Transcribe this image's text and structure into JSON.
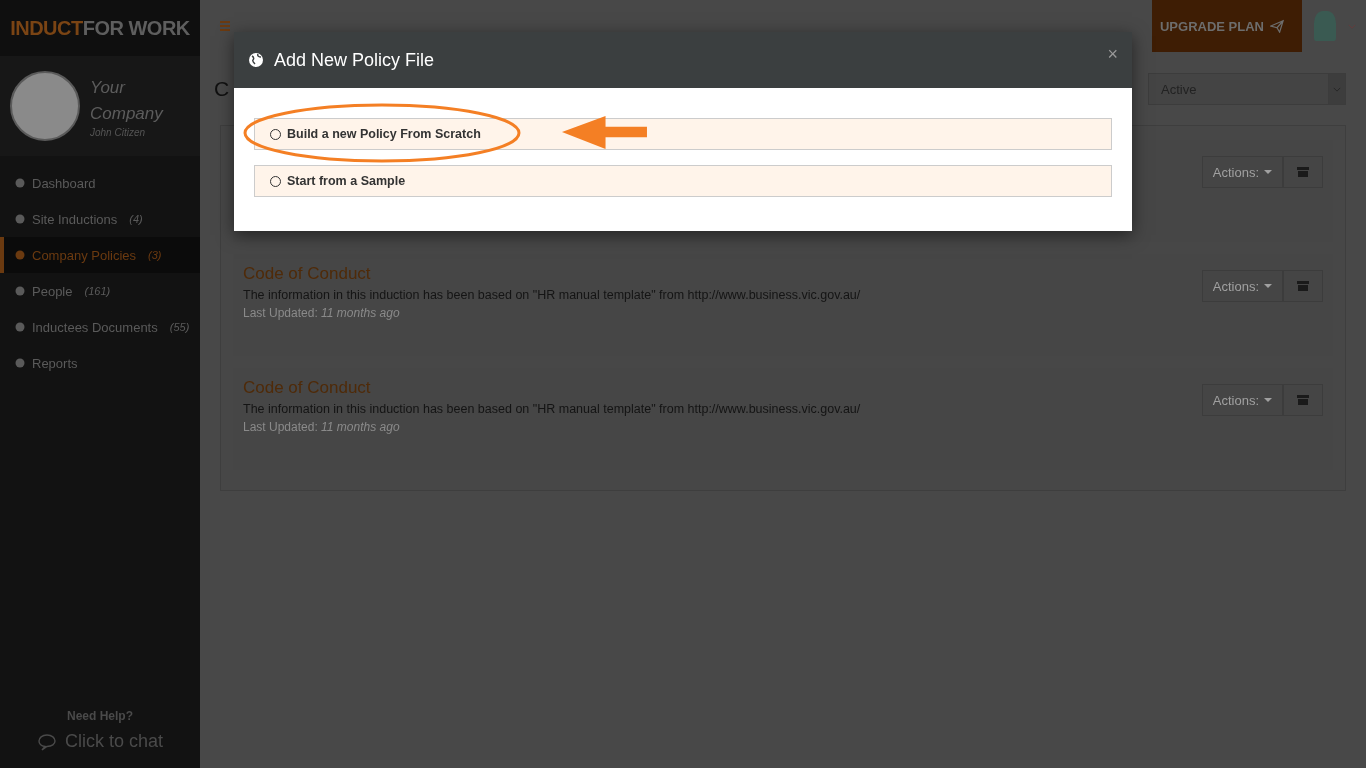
{
  "brand": {
    "part_1": "INDUCT",
    "part_2": "FOR WORK"
  },
  "profile": {
    "company_line_1": "Your",
    "company_line_2": "Company",
    "user": "John Citizen"
  },
  "sidebar": {
    "items": [
      {
        "label": "Dashboard",
        "selected": false
      },
      {
        "label": "Site Inductions",
        "count": "(4)",
        "selected": false
      },
      {
        "label": "Company Policies",
        "count": "(3)",
        "selected": true
      },
      {
        "label": "People",
        "count": "(161)",
        "selected": false
      },
      {
        "label": "Inductees Documents",
        "count": "(55)",
        "selected": false
      },
      {
        "label": "Reports",
        "selected": false
      }
    ],
    "help_title": "Need Help?",
    "chat": "Click to chat"
  },
  "topbar": {
    "upgrade": "UPGRADE PLAN"
  },
  "page": {
    "title": "C",
    "status_filter": "Active"
  },
  "policies": [
    {
      "actions": "Actions:"
    },
    {
      "title": "Code of Conduct",
      "description": "The information in this induction has been based on \"HR manual template\" from http://www.business.vic.gov.au/",
      "updated_label": "Last Updated:",
      "updated": "11 months ago",
      "actions": "Actions:"
    },
    {
      "title": "Code of Conduct",
      "description": "The information in this induction has been based on \"HR manual template\" from http://www.business.vic.gov.au/",
      "updated_label": "Last Updated:",
      "updated": "11 months ago",
      "actions": "Actions:"
    }
  ],
  "modal": {
    "title": "Add New Policy File",
    "close": "×",
    "options": [
      {
        "label": "Build a new Policy From Scratch",
        "selected": false
      },
      {
        "label": "Start from a Sample",
        "selected": false
      }
    ]
  }
}
